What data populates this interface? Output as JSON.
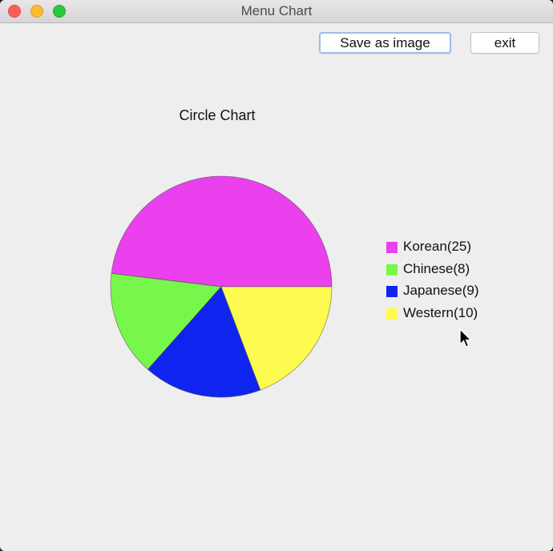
{
  "window": {
    "title": "Menu Chart"
  },
  "toolbar": {
    "save_label": "Save as image",
    "exit_label": "exit"
  },
  "chart_data": {
    "type": "pie",
    "title": "Circle Chart",
    "slices": [
      {
        "label": "Korean(25)",
        "name": "Korean",
        "value": 25,
        "color": "#ea40ee"
      },
      {
        "label": "Chinese(8)",
        "name": "Chinese",
        "value": 8,
        "color": "#77f74c"
      },
      {
        "label": "Japanese(9)",
        "name": "Japanese",
        "value": 9,
        "color": "#0f25ef"
      },
      {
        "label": "Western(10)",
        "name": "Western",
        "value": 10,
        "color": "#fdfb4f"
      }
    ],
    "legend_position": "right"
  }
}
